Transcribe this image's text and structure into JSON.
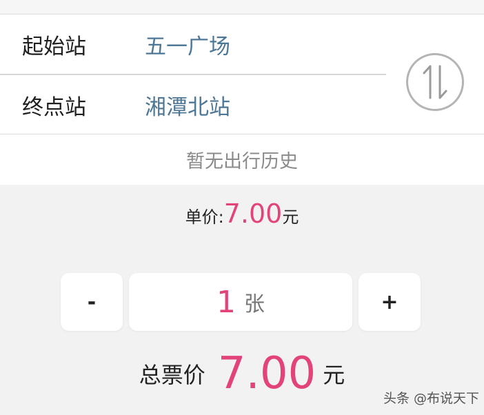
{
  "stations": {
    "start": {
      "label": "起始站",
      "value": "五一广场"
    },
    "end": {
      "label": "终点站",
      "value": "湘潭北站"
    }
  },
  "swap": {
    "icon": "swap-arrows-icon"
  },
  "history": {
    "empty_text": "暂无出行历史"
  },
  "price": {
    "label": "单价:",
    "value": "7.00",
    "unit": "元"
  },
  "quantity": {
    "minus_label": "-",
    "count": "1",
    "unit": "张",
    "plus_label": "+"
  },
  "total": {
    "label": "总票价",
    "value": "7.00",
    "unit": "元"
  },
  "watermark": "头条 @布说天下",
  "colors": {
    "accent": "#e2437a",
    "station_value": "#4e7796",
    "background": "#f2f2f2"
  }
}
